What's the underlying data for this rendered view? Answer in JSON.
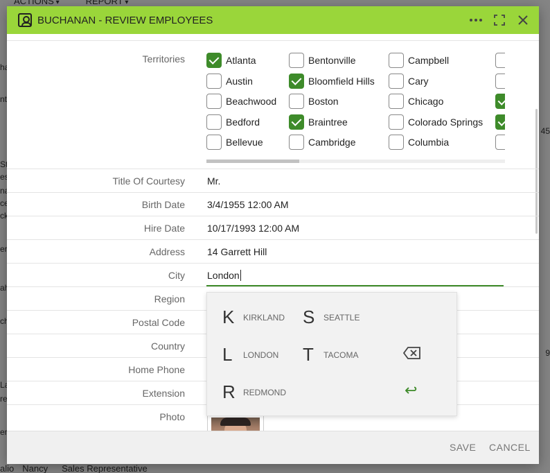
{
  "background": {
    "menu": [
      "ACTIONS",
      "REPORT"
    ],
    "left_fragments": [
      "ha",
      "nt",
      "St",
      "es",
      "na",
      "ce",
      "ck",
      "er",
      "ah",
      "ch",
      "La",
      "re",
      "er"
    ],
    "right_fragments": [
      "45",
      "9"
    ],
    "bottom_row": [
      "alio",
      "Nancy",
      "Sales Representative"
    ]
  },
  "dialog": {
    "title": "BUCHANAN - REVIEW EMPLOYEES",
    "header_color": "#9ad63a",
    "icons": [
      "contact-card-icon",
      "more-icon",
      "fullscreen-icon",
      "close-icon"
    ]
  },
  "fields": {
    "territories": {
      "label": "Territories",
      "columns": [
        [
          {
            "name": "Atlanta",
            "checked": true
          },
          {
            "name": "Austin",
            "checked": false
          },
          {
            "name": "Beachwood",
            "checked": false
          },
          {
            "name": "Bedford",
            "checked": false
          },
          {
            "name": "Bellevue",
            "checked": false
          }
        ],
        [
          {
            "name": "Bentonville",
            "checked": false
          },
          {
            "name": "Bloomfield Hills",
            "checked": true
          },
          {
            "name": "Boston",
            "checked": false
          },
          {
            "name": "Braintree",
            "checked": true
          },
          {
            "name": "Cambridge",
            "checked": false
          }
        ],
        [
          {
            "name": "Campbell",
            "checked": false
          },
          {
            "name": "Cary",
            "checked": false
          },
          {
            "name": "Chicago",
            "checked": false
          },
          {
            "name": "Colorado Springs",
            "checked": false
          },
          {
            "name": "Columbia",
            "checked": false
          }
        ],
        [
          {
            "name": "",
            "checked": false
          },
          {
            "name": "",
            "checked": false
          },
          {
            "name": "",
            "checked": true
          },
          {
            "name": "",
            "checked": true
          },
          {
            "name": "",
            "checked": false
          }
        ]
      ]
    },
    "title_of_courtesy": {
      "label": "Title Of Courtesy",
      "value": "Mr."
    },
    "birth_date": {
      "label": "Birth Date",
      "value": "3/4/1955 12:00 AM"
    },
    "hire_date": {
      "label": "Hire Date",
      "value": "10/17/1993 12:00 AM"
    },
    "address": {
      "label": "Address",
      "value": "14 Garrett Hill"
    },
    "city": {
      "label": "City",
      "value": "London"
    },
    "region": {
      "label": "Region"
    },
    "postal_code": {
      "label": "Postal Code"
    },
    "country": {
      "label": "Country"
    },
    "home_phone": {
      "label": "Home Phone"
    },
    "extension": {
      "label": "Extension"
    },
    "photo": {
      "label": "Photo"
    }
  },
  "autocomplete": {
    "items": [
      {
        "letter": "K",
        "word": "KIRKLAND"
      },
      {
        "letter": "S",
        "word": "SEATTLE"
      },
      {
        "letter": "L",
        "word": "LONDON"
      },
      {
        "letter": "T",
        "word": "TACOMA"
      },
      {
        "letter": "R",
        "word": "REDMOND"
      }
    ],
    "delete_icon": "backspace-icon",
    "enter_icon": "enter-icon",
    "enter_glyph": "↩"
  },
  "footer": {
    "save": "SAVE",
    "cancel": "CANCEL"
  },
  "accent": "#3e8b2a"
}
